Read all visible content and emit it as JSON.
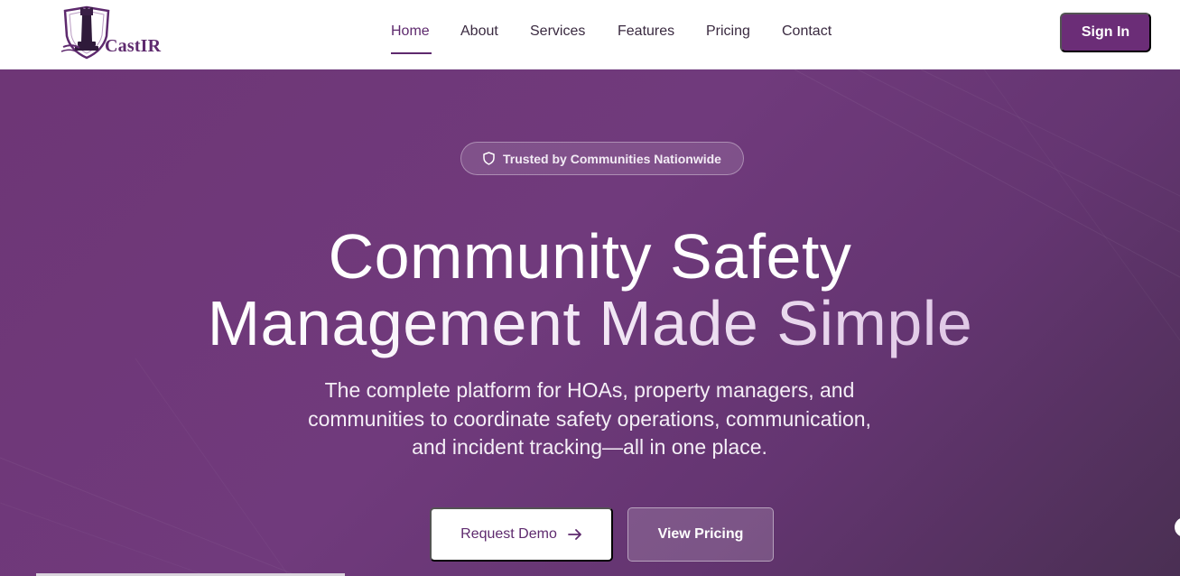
{
  "brand": {
    "name": "CastIR",
    "logo_icon": "rook-shield-logo"
  },
  "nav": {
    "items": [
      {
        "label": "Home",
        "active": true
      },
      {
        "label": "About",
        "active": false
      },
      {
        "label": "Services",
        "active": false
      },
      {
        "label": "Features",
        "active": false
      },
      {
        "label": "Pricing",
        "active": false
      },
      {
        "label": "Contact",
        "active": false
      }
    ],
    "signin_label": "Sign In"
  },
  "hero": {
    "badge_icon": "shield-icon",
    "badge": "Trusted by Communities Nationwide",
    "title_line1": "Community Safety",
    "title_line2": "Management Made Simple",
    "subtitle_line1": "The complete platform for HOAs, property managers, and",
    "subtitle_line2": "communities to coordinate safety operations, communication,",
    "subtitle_line3": "and incident tracking—all in one place.",
    "primary_button": "Request Demo",
    "primary_button_icon": "arrow-right-icon",
    "secondary_button": "View Pricing"
  },
  "colors": {
    "brand": "#6b2d77",
    "hero_bg": "#6e3676",
    "nav_text": "#3a2a40"
  }
}
